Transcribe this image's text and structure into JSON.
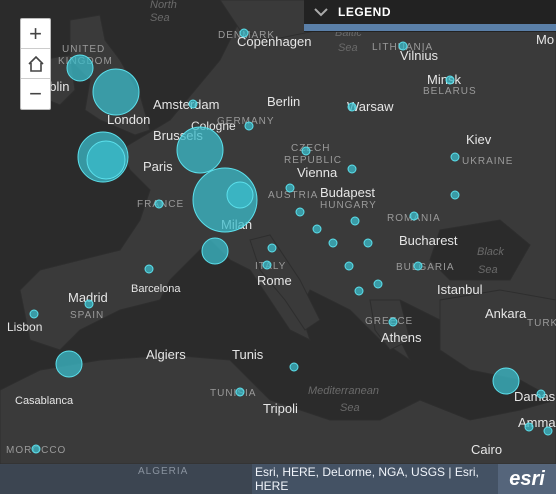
{
  "controls": {
    "zoom_in": "+",
    "zoom_out": "−"
  },
  "legend": {
    "title": "LEGEND"
  },
  "attribution": "Esri, HERE, DeLorme, NGA, USGS | Esri, HERE",
  "logo": "esri",
  "colors": {
    "background": "#2b2b2b",
    "land": "#3a3a3a",
    "marker_fill": "#3bbccb",
    "marker_stroke": "#5ce0ec",
    "legend_accent": "#5a7fa8"
  },
  "labels": [
    {
      "t": "North",
      "k": "water"
    },
    {
      "t": "Sea",
      "k": "water"
    },
    {
      "t": "Baltic",
      "k": "water"
    },
    {
      "t": "Sea",
      "k": "water"
    },
    {
      "t": "UNITED",
      "k": "country"
    },
    {
      "t": "KINGDOM",
      "k": "country"
    },
    {
      "t": "DENMARK",
      "k": "country"
    },
    {
      "t": "LITHUANIA",
      "k": "country"
    },
    {
      "t": "Mo",
      "k": "city"
    },
    {
      "t": "Copenhagen",
      "k": "city"
    },
    {
      "t": "Vilnius",
      "k": "city"
    },
    {
      "t": "Minsk",
      "k": "city"
    },
    {
      "t": "BELARUS",
      "k": "country"
    },
    {
      "t": "ublin",
      "k": "city"
    },
    {
      "t": "Amsterdam",
      "k": "city"
    },
    {
      "t": "Berlin",
      "k": "city"
    },
    {
      "t": "Warsaw",
      "k": "city"
    },
    {
      "t": "London",
      "k": "city"
    },
    {
      "t": "GERMANY",
      "k": "country"
    },
    {
      "t": "Cologne",
      "k": "city"
    },
    {
      "t": "Brussels",
      "k": "city"
    },
    {
      "t": "CZECH",
      "k": "country"
    },
    {
      "t": "REPUBLIC",
      "k": "country"
    },
    {
      "t": "Kiev",
      "k": "city"
    },
    {
      "t": "UKRAINE",
      "k": "country"
    },
    {
      "t": "Paris",
      "k": "city"
    },
    {
      "t": "Vienna",
      "k": "city"
    },
    {
      "t": "AUSTRIA",
      "k": "country"
    },
    {
      "t": "Budapest",
      "k": "city"
    },
    {
      "t": "HUNGARY",
      "k": "country"
    },
    {
      "t": "FRANCE",
      "k": "country"
    },
    {
      "t": "Milan",
      "k": "city"
    },
    {
      "t": "ROMANIA",
      "k": "country"
    },
    {
      "t": "Bucharest",
      "k": "city"
    },
    {
      "t": "Black",
      "k": "water"
    },
    {
      "t": "Sea",
      "k": "water"
    },
    {
      "t": "ITALY",
      "k": "country"
    },
    {
      "t": "BULGARIA",
      "k": "country"
    },
    {
      "t": "Rome",
      "k": "city"
    },
    {
      "t": "Barcelona",
      "k": "city"
    },
    {
      "t": "Istanbul",
      "k": "city"
    },
    {
      "t": "Madrid",
      "k": "city"
    },
    {
      "t": "SPAIN",
      "k": "country"
    },
    {
      "t": "Ankara",
      "k": "city"
    },
    {
      "t": "TURKE",
      "k": "country"
    },
    {
      "t": "Lisbon",
      "k": "city"
    },
    {
      "t": "GREECE",
      "k": "country"
    },
    {
      "t": "Athens",
      "k": "city"
    },
    {
      "t": "Algiers",
      "k": "city"
    },
    {
      "t": "Tunis",
      "k": "city"
    },
    {
      "t": "Casablanca",
      "k": "city"
    },
    {
      "t": "TUNISIA",
      "k": "country"
    },
    {
      "t": "Mediterranean",
      "k": "water"
    },
    {
      "t": "Sea",
      "k": "water"
    },
    {
      "t": "Tripoli",
      "k": "city"
    },
    {
      "t": "Damas",
      "k": "city"
    },
    {
      "t": "Amma",
      "k": "city"
    },
    {
      "t": "MOROCCO",
      "k": "country"
    },
    {
      "t": "Cairo",
      "k": "city"
    },
    {
      "t": "ALGERIA",
      "k": "country"
    }
  ],
  "markers": [
    {
      "name": "ireland",
      "size": "medium"
    },
    {
      "name": "london",
      "size": "large"
    },
    {
      "name": "copenhagen",
      "size": "small"
    },
    {
      "name": "vilnius",
      "size": "small"
    },
    {
      "name": "minsk",
      "size": "small"
    },
    {
      "name": "amsterdam",
      "size": "small"
    },
    {
      "name": "warsaw",
      "size": "small"
    },
    {
      "name": "cologne",
      "size": "small"
    },
    {
      "name": "brussels",
      "size": "large"
    },
    {
      "name": "nantes",
      "size": "large"
    },
    {
      "name": "bordeaux-west",
      "size": "large"
    },
    {
      "name": "prague",
      "size": "small"
    },
    {
      "name": "kiev",
      "size": "small"
    },
    {
      "name": "vienna",
      "size": "small"
    },
    {
      "name": "budapest",
      "size": "small"
    },
    {
      "name": "east-ukraine",
      "size": "small"
    },
    {
      "name": "france-west",
      "size": "small"
    },
    {
      "name": "milan",
      "size": "xlarge"
    },
    {
      "name": "swiss",
      "size": "medium"
    },
    {
      "name": "slovenia",
      "size": "small"
    },
    {
      "name": "croatia",
      "size": "small"
    },
    {
      "name": "serbia",
      "size": "small"
    },
    {
      "name": "romania",
      "size": "small"
    },
    {
      "name": "bucharest",
      "size": "small"
    },
    {
      "name": "bulgaria",
      "size": "small"
    },
    {
      "name": "marseille",
      "size": "medium"
    },
    {
      "name": "italy-1",
      "size": "small"
    },
    {
      "name": "italy-2",
      "size": "small"
    },
    {
      "name": "montpellier",
      "size": "small"
    },
    {
      "name": "sofia",
      "size": "small"
    },
    {
      "name": "bosnia",
      "size": "small"
    },
    {
      "name": "madrid",
      "size": "small"
    },
    {
      "name": "lisbon",
      "size": "small"
    },
    {
      "name": "north-macedonia",
      "size": "small"
    },
    {
      "name": "athens",
      "size": "small"
    },
    {
      "name": "malaga",
      "size": "medium"
    },
    {
      "name": "palermo",
      "size": "small"
    },
    {
      "name": "tunis",
      "size": "small"
    },
    {
      "name": "antalya",
      "size": "medium"
    },
    {
      "name": "cyprus",
      "size": "small"
    },
    {
      "name": "beirut",
      "size": "small"
    },
    {
      "name": "amman",
      "size": "small"
    },
    {
      "name": "morocco",
      "size": "small"
    },
    {
      "name": "algeria",
      "size": "small"
    }
  ]
}
